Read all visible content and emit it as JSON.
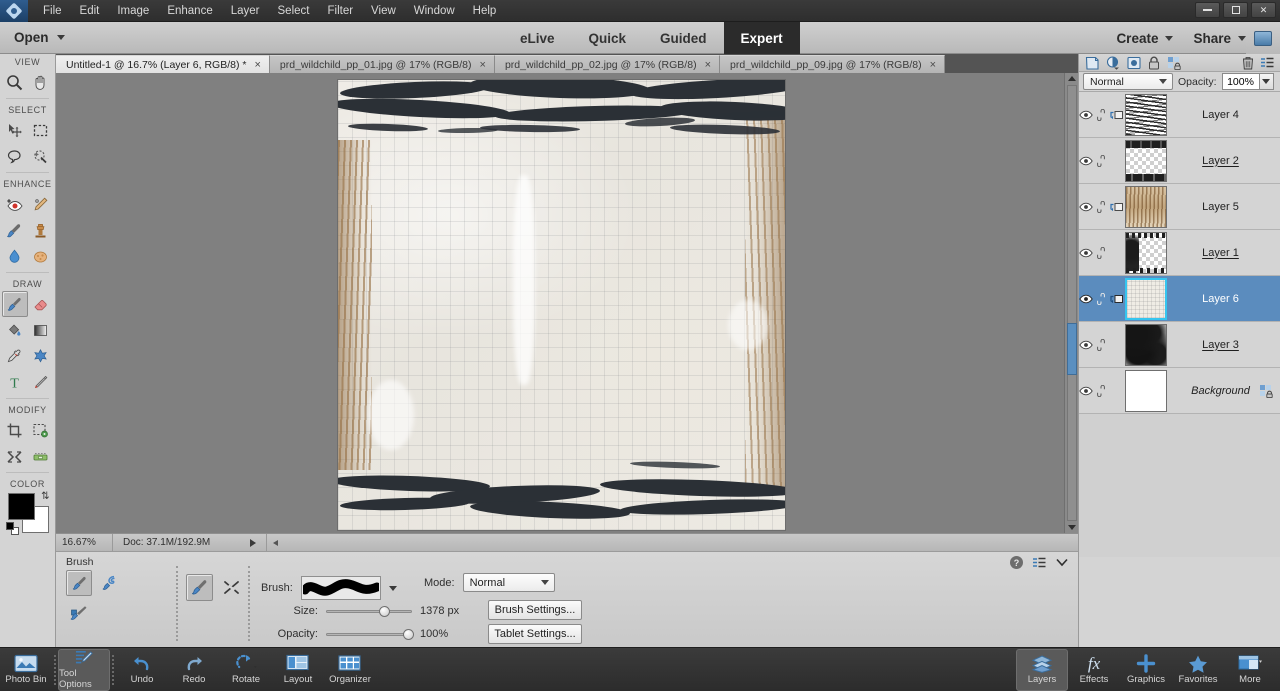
{
  "window": {
    "app_icon": "photoshop-elements-logo",
    "controls": {
      "minimize": "minimize-icon",
      "maximize": "maximize-icon",
      "close": "✕"
    }
  },
  "menubar": {
    "items": [
      "File",
      "Edit",
      "Image",
      "Enhance",
      "Layer",
      "Select",
      "Filter",
      "View",
      "Window",
      "Help"
    ]
  },
  "modebar": {
    "open_label": "Open",
    "modes": [
      {
        "label": "eLive",
        "active": false
      },
      {
        "label": "Quick",
        "active": false
      },
      {
        "label": "Guided",
        "active": false
      },
      {
        "label": "Expert",
        "active": true
      }
    ],
    "create_label": "Create",
    "share_label": "Share"
  },
  "tabs": [
    {
      "label": "Untitled-1 @ 16.7% (Layer 6, RGB/8) *",
      "active": true,
      "close": "×"
    },
    {
      "label": "prd_wildchild_pp_01.jpg @ 17% (RGB/8)",
      "active": false,
      "close": "×"
    },
    {
      "label": "prd_wildchild_pp_02.jpg @ 17% (RGB/8)",
      "active": false,
      "close": "×"
    },
    {
      "label": "prd_wildchild_pp_09.jpg @ 17% (RGB/8)",
      "active": false,
      "close": "×"
    }
  ],
  "toolbox": {
    "sections": [
      {
        "title": "VIEW",
        "tools": [
          "zoom-tool",
          "hand-tool"
        ]
      },
      {
        "title": "SELECT",
        "tools": [
          "move-tool",
          "rectangular-marquee-tool",
          "lasso-tool",
          "quick-selection-tool"
        ]
      },
      {
        "title": "ENHANCE",
        "tools": [
          "red-eye-removal-tool",
          "spot-healing-brush-tool",
          "smart-brush-tool",
          "clone-stamp-tool",
          "blur-tool",
          "sponge-tool"
        ]
      },
      {
        "title": "DRAW",
        "tools": [
          "brush-tool",
          "eraser-tool",
          "paint-bucket-tool",
          "gradient-tool",
          "eyedropper-tool",
          "custom-shape-tool",
          "type-tool",
          "pencil-tool"
        ]
      },
      {
        "title": "MODIFY",
        "tools": [
          "crop-tool",
          "content-aware-move-tool",
          "recompose-tool",
          "straighten-tool"
        ]
      }
    ],
    "color_section": {
      "title": "COLOR",
      "foreground": "#000000",
      "background": "#ffffff",
      "swap_icon": "swap-colors-icon",
      "default_icon": "default-colors-icon"
    },
    "selected_tool": "brush-tool"
  },
  "canvas": {
    "status": {
      "zoom": "16.67%",
      "doc_info": "Doc: 37.1M/192.9M"
    },
    "scrollbar": {
      "name": "canvas-vertical-scrollbar"
    }
  },
  "tool_options": {
    "title": "Brush",
    "variants": [
      "brush-tool",
      "impressionist-brush-tool",
      "color-replacement-tool"
    ],
    "mode_tools": [
      "brush-preset-tool",
      "airbrush-tool"
    ],
    "brush_label": "Brush:",
    "brush_preview": "soft-round-stroke-preview",
    "size_label": "Size:",
    "size_value": "1378 px",
    "size_pct": 66,
    "opacity_label": "Opacity:",
    "opacity_value": "100%",
    "opacity_pct": 94,
    "mode_label": "Mode:",
    "mode_value": "Normal",
    "brush_settings_label": "Brush Settings...",
    "tablet_settings_label": "Tablet Settings...",
    "help_icon": "help-icon",
    "menu_icon": "panel-menu-icon",
    "collapse_icon": "chevron-down-icon"
  },
  "layers_panel": {
    "icon_bar": [
      "new-layer-icon",
      "new-adjustment-layer-icon",
      "layer-mask-icon",
      "lock-layer-icon",
      "group-layers-icon",
      "delete-layer-icon",
      "panel-menu-icon"
    ],
    "blend_mode": "Normal",
    "opacity_label": "Opacity:",
    "opacity_value": "100%",
    "layers": [
      {
        "name": "Layer 4",
        "thumb": "stripes",
        "visible": true,
        "selected": false,
        "clipped": true,
        "locked": false,
        "italic": false,
        "underline": false
      },
      {
        "name": "Layer 2",
        "thumb": "edge-dark",
        "visible": true,
        "selected": false,
        "clipped": false,
        "locked": false,
        "italic": false,
        "underline": true
      },
      {
        "name": "Layer 5",
        "thumb": "wood",
        "visible": true,
        "selected": false,
        "clipped": true,
        "locked": false,
        "italic": false,
        "underline": false
      },
      {
        "name": "Layer 1",
        "thumb": "blot-left",
        "visible": true,
        "selected": false,
        "clipped": false,
        "locked": false,
        "italic": false,
        "underline": true
      },
      {
        "name": "Layer 6",
        "thumb": "paper",
        "visible": true,
        "selected": true,
        "clipped": true,
        "locked": false,
        "italic": false,
        "underline": false
      },
      {
        "name": "Layer 3",
        "thumb": "splatter",
        "visible": true,
        "selected": false,
        "clipped": false,
        "locked": false,
        "italic": false,
        "underline": true
      },
      {
        "name": "Background",
        "thumb": "white",
        "visible": true,
        "selected": false,
        "clipped": false,
        "locked": true,
        "italic": true,
        "underline": false
      }
    ]
  },
  "taskbar": {
    "left_items": [
      {
        "label": "Photo Bin",
        "icon": "photo-bin-icon",
        "active": false
      },
      {
        "label": "Tool Options",
        "icon": "tool-options-icon",
        "active": true
      },
      {
        "label": "Undo",
        "icon": "undo-icon",
        "active": false
      },
      {
        "label": "Redo",
        "icon": "redo-icon",
        "active": false
      },
      {
        "label": "Rotate",
        "icon": "rotate-icon",
        "active": false
      },
      {
        "label": "Layout",
        "icon": "layout-icon",
        "active": false
      },
      {
        "label": "Organizer",
        "icon": "organizer-icon",
        "active": false
      }
    ],
    "right_items": [
      {
        "label": "Layers",
        "icon": "layers-icon",
        "active": true
      },
      {
        "label": "Effects",
        "icon": "effects-icon",
        "active": false
      },
      {
        "label": "Graphics",
        "icon": "graphics-icon",
        "active": false
      },
      {
        "label": "Favorites",
        "icon": "favorites-icon",
        "active": false
      },
      {
        "label": "More",
        "icon": "more-icon",
        "active": false
      }
    ]
  },
  "colors": {
    "accent_blue": "#5b8cbe",
    "selection_cyan": "#35c5ef",
    "panel_gray": "#d4d4d4",
    "dark_chrome": "#2c2c2c"
  }
}
